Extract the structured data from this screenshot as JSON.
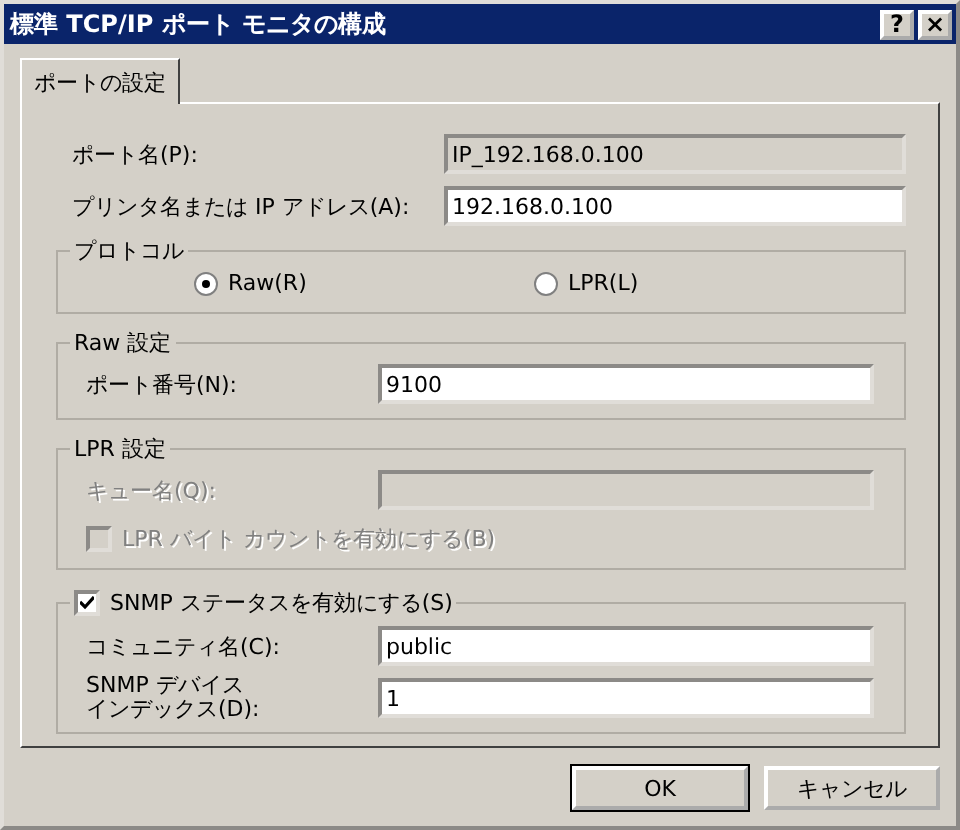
{
  "window": {
    "title": "標準 TCP/IP ポート モニタの構成",
    "help": "?",
    "close": "×"
  },
  "tabs": [
    {
      "label": "ポートの設定",
      "selected": true
    }
  ],
  "fields": [
    {
      "label": "ポート名(P):",
      "value": "IP_192.168.0.100",
      "readonly": true
    },
    {
      "label": "プリンタ名または IP アドレス(A):",
      "value": "192.168.0.100",
      "readonly": false
    }
  ],
  "protocol": {
    "title": "プロトコル",
    "options": [
      {
        "label": "Raw(R)",
        "selected": true
      },
      {
        "label": "LPR(L)",
        "selected": false
      }
    ]
  },
  "raw_settings": {
    "title": "Raw 設定",
    "port_number": {
      "label": "ポート番号(N):",
      "value": "9100"
    }
  },
  "lpr_settings": {
    "title": "LPR 設定",
    "disabled": true,
    "queue_name": {
      "label": "キュー名(Q):"
    },
    "byte_counting": {
      "label": "LPR バイト カウントを有効にする(B)",
      "checked": false
    }
  },
  "snmp": {
    "label": "SNMP ステータスを有効にする(S)",
    "checked": true,
    "fields": [
      {
        "label": "コミュニティ名(C):",
        "value": "public"
      },
      {
        "label_lines": [
          "SNMP デバイス",
          "インデックス(D):"
        ],
        "value": "1"
      }
    ]
  },
  "buttons": [
    {
      "label": "OK",
      "default": true
    },
    {
      "label": "キャンセル",
      "default": false
    }
  ]
}
